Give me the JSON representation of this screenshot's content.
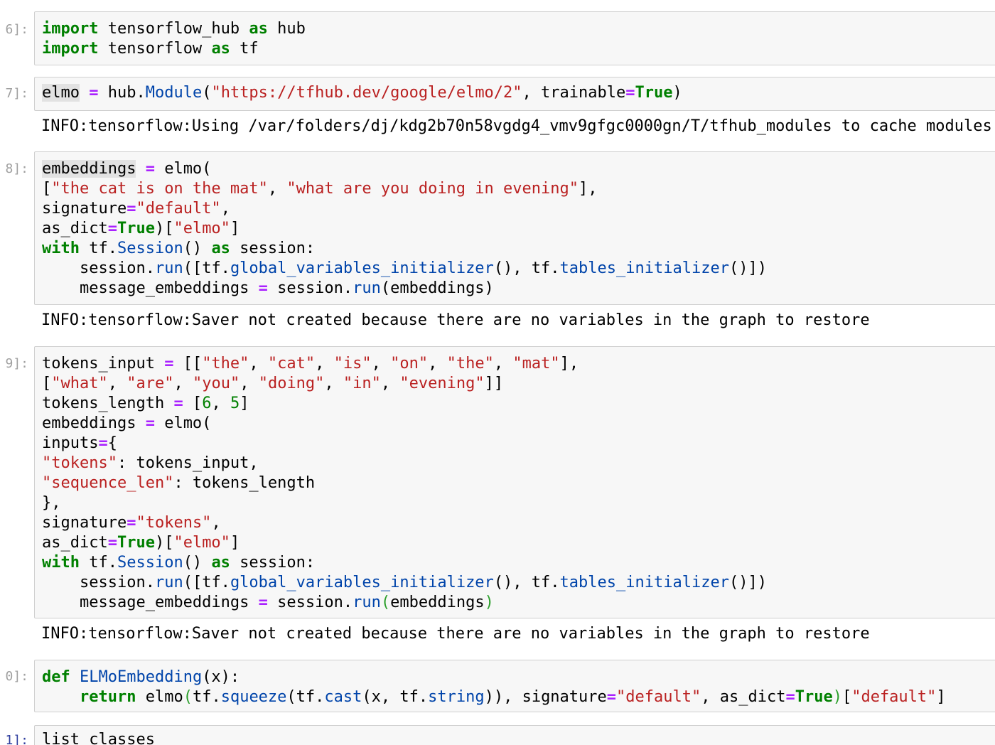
{
  "cells": [
    {
      "prompt": "6]:",
      "lines": [
        "import tensorflow_hub as hub",
        "import tensorflow as tf"
      ]
    },
    {
      "prompt": "7]:",
      "lines": [
        "elmo = hub.Module(\"https://tfhub.dev/google/elmo/2\", trainable=True)"
      ],
      "output": "INFO:tensorflow:Using /var/folders/dj/kdg2b70n58vgdg4_vmv9gfgc0000gn/T/tfhub_modules to cache modules."
    },
    {
      "prompt": "8]:",
      "lines": [
        "embeddings = elmo(",
        "[\"the cat is on the mat\", \"what are you doing in evening\"],",
        "signature=\"default\",",
        "as_dict=True)[\"elmo\"]",
        "with tf.Session() as session:",
        "    session.run([tf.global_variables_initializer(), tf.tables_initializer()])",
        "    message_embeddings = session.run(embeddings)"
      ],
      "output": "INFO:tensorflow:Saver not created because there are no variables in the graph to restore"
    },
    {
      "prompt": "9]:",
      "lines": [
        "tokens_input = [[\"the\", \"cat\", \"is\", \"on\", \"the\", \"mat\"],",
        "[\"what\", \"are\", \"you\", \"doing\", \"in\", \"evening\"]]",
        "tokens_length = [6, 5]",
        "embeddings = elmo(",
        "inputs={",
        "\"tokens\": tokens_input,",
        "\"sequence_len\": tokens_length",
        "},",
        "signature=\"tokens\",",
        "as_dict=True)[\"elmo\"]",
        "with tf.Session() as session:",
        "    session.run([tf.global_variables_initializer(), tf.tables_initializer()])",
        "    message_embeddings = session.run(embeddings)"
      ],
      "output": "INFO:tensorflow:Saver not created because there are no variables in the graph to restore"
    },
    {
      "prompt": "0]:",
      "lines": [
        "def ELMoEmbedding(x):",
        "    return elmo(tf.squeeze(tf.cast(x, tf.string)), signature=\"default\", as_dict=True)[\"default\"]"
      ]
    },
    {
      "prompt": "1]:",
      "lines": [
        "list_classes"
      ]
    }
  ]
}
